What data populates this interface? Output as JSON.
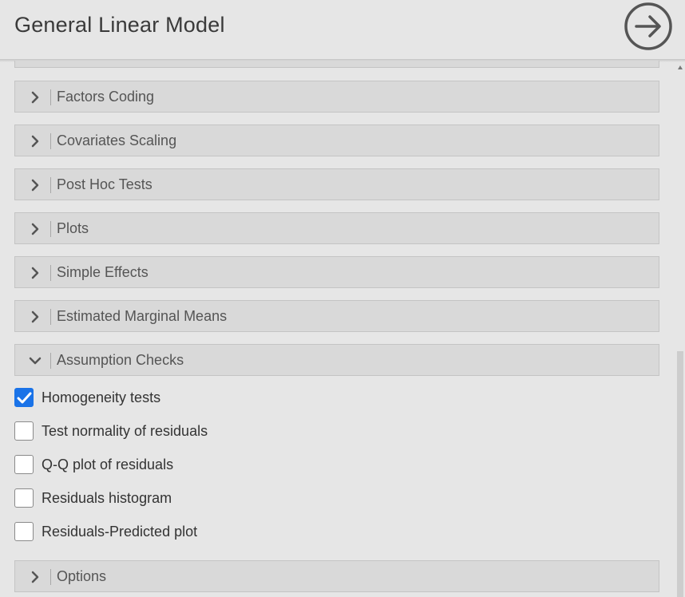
{
  "header": {
    "title": "General Linear Model",
    "close_icon": "arrow-right-circle-icon"
  },
  "sections_above": [
    {
      "label": "Factors Coding",
      "expanded": false
    },
    {
      "label": "Covariates Scaling",
      "expanded": false
    },
    {
      "label": "Post Hoc Tests",
      "expanded": false
    },
    {
      "label": "Plots",
      "expanded": false
    },
    {
      "label": "Simple Effects",
      "expanded": false
    },
    {
      "label": "Estimated Marginal Means",
      "expanded": false
    },
    {
      "label": "Assumption Checks",
      "expanded": true
    }
  ],
  "assumption_checks": [
    {
      "label": "Homogeneity tests",
      "checked": true
    },
    {
      "label": "Test normality of residuals",
      "checked": false
    },
    {
      "label": "Q-Q plot of residuals",
      "checked": false
    },
    {
      "label": "Residuals histogram",
      "checked": false
    },
    {
      "label": "Residuals-Predicted plot",
      "checked": false
    }
  ],
  "sections_below": [
    {
      "label": "Options",
      "expanded": false
    }
  ],
  "colors": {
    "accent": "#1a73e8",
    "section_bg": "#d9d9d9",
    "page_bg": "#e6e6e6"
  }
}
